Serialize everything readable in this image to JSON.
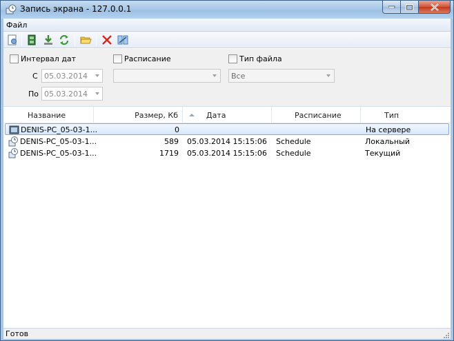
{
  "window": {
    "title": "Запись экрана - 127.0.0.1"
  },
  "menu": {
    "file": "Файл"
  },
  "toolbar": {
    "buttons": [
      "settings-icon",
      "record-icon",
      "download-icon",
      "refresh-icon",
      "open-folder-icon",
      "delete-icon",
      "compare-icon"
    ]
  },
  "filters": {
    "date_interval_label": "Интервал дат",
    "schedule_label": "Расписание",
    "file_type_label": "Тип файла",
    "from_label": "С",
    "to_label": "По",
    "from_value": "05.03.2014",
    "to_value": "05.03.2014",
    "schedule_value": "",
    "file_type_value": "Все"
  },
  "table": {
    "columns": [
      "Название",
      "Размер, Кб",
      "Дата",
      "Расписание",
      "Тип"
    ],
    "rows": [
      {
        "name": "DENIS-PC_05-03-1...",
        "size": "0",
        "date": "",
        "schedule": "",
        "type": "На сервере"
      },
      {
        "name": "DENIS-PC_05-03-1...",
        "size": "589",
        "date": "05.03.2014 15:15:06",
        "schedule": "Schedule",
        "type": "Локальный"
      },
      {
        "name": "DENIS-PC_05-03-1...",
        "size": "1719",
        "date": "05.03.2014 15:15:06",
        "schedule": "Schedule",
        "type": "Текущий"
      }
    ]
  },
  "status": {
    "text": "Готов"
  }
}
